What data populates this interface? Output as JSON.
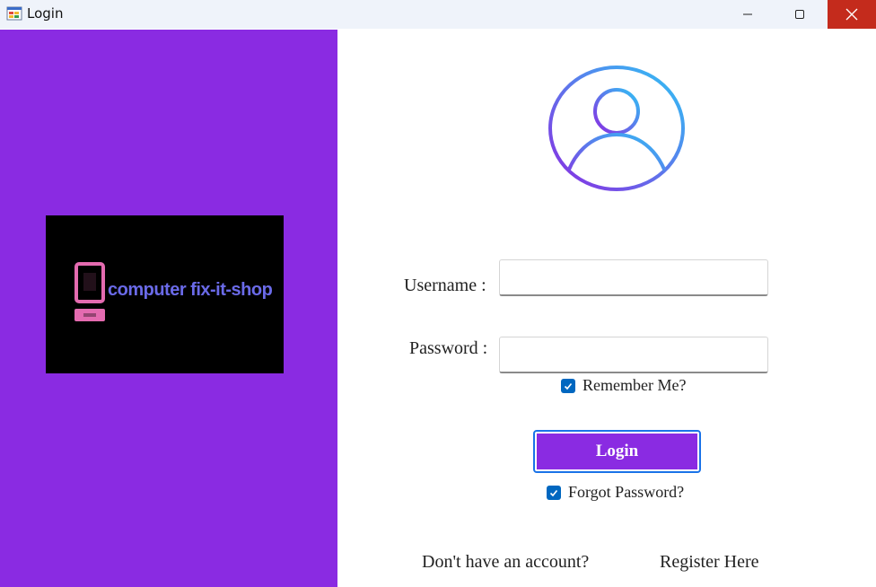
{
  "window": {
    "title": "Login",
    "icon": "windows-form-icon",
    "controls": [
      "minimize-icon",
      "maximize-icon",
      "close-icon"
    ],
    "close_color": "#c42b1c"
  },
  "left_panel": {
    "background": "#8a2be2",
    "logo": {
      "text": "computer fix-it-shop",
      "icon": "computer-monitor-icon",
      "text_color": "#6a6ae8",
      "icon_color": "#e46bb0"
    }
  },
  "form": {
    "avatar_icon": "user-circle-icon",
    "username_label": "Username :",
    "username_value": "",
    "password_label": "Password :",
    "password_value": "",
    "remember_label": "Remember Me?",
    "remember_checked": true,
    "login_label": "Login",
    "forgot_label": "Forgot Password?",
    "forgot_checked": true,
    "no_account_text": "Don't have an account?",
    "register_label": "Register Here",
    "accent": "#8a2be2",
    "checkbox_color": "#0067c0"
  }
}
